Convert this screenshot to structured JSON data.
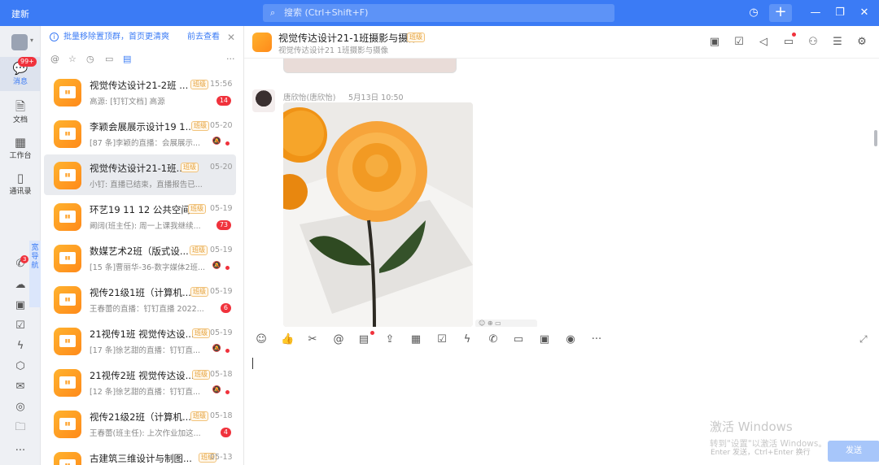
{
  "titlebar": {
    "app_title": "建新",
    "search_placeholder": "搜索 (Ctrl+Shift+F)",
    "icons": [
      "history-icon",
      "plus-icon",
      "minimize-icon",
      "restore-icon",
      "close-icon"
    ]
  },
  "leftnav": {
    "items": [
      {
        "label": "消息",
        "icon": "message-icon",
        "badge": "99+",
        "active": true
      },
      {
        "label": "文档",
        "icon": "document-icon"
      },
      {
        "label": "工作台",
        "icon": "workbench-icon"
      },
      {
        "label": "通讯录",
        "icon": "contacts-icon"
      }
    ],
    "wide_nav_label": "宽导航",
    "call_badge": "3",
    "more_label": "..."
  },
  "notice": {
    "message": "批量移除置顶群，首页更清爽",
    "link": "前去查看"
  },
  "conversations": [
    {
      "name": "视觉传达设计21-2班 ...",
      "tag": "班级",
      "time": "15:56",
      "preview": "高源: [钉钉文档] 高源",
      "badge": "14"
    },
    {
      "name": "李颖会展展示设计19 1...",
      "tag": "班级",
      "time": "05-20",
      "preview": "[87 条]李颖的直播：会展展示...",
      "muted": true,
      "dot": true
    },
    {
      "name": "视觉传达设计21-1班...",
      "tag": "班级",
      "time": "05-20",
      "preview": "小钉: 直播已结束，直播报告已...",
      "selected": true
    },
    {
      "name": "环艺19 11 12 公共空间",
      "tag": "班级",
      "time": "05-19",
      "preview": "阚阔(班主任): 周一上课我继续...",
      "badge": "73"
    },
    {
      "name": "数媒艺术2班（版式设...",
      "tag": "班级",
      "time": "05-19",
      "preview": "[15 条]曹丽华-36-数字媒体2班...",
      "muted": true,
      "dot": true
    },
    {
      "name": "视传21级1班（计算机...",
      "tag": "班级",
      "time": "05-19",
      "preview": "王春蕾的直播：钉钉直播 2022...",
      "badge": "6"
    },
    {
      "name": "21视传1班 视觉传达设...",
      "tag": "班级",
      "time": "05-19",
      "preview": "[17 条]徐艺甜的直播：钉钉直...",
      "muted": true,
      "dot": true
    },
    {
      "name": "21视传2班 视觉传达设...",
      "tag": "班级",
      "time": "05-18",
      "preview": "[12 条]徐艺甜的直播：钉钉直...",
      "muted": true,
      "dot": true
    },
    {
      "name": "视传21级2班（计算机...",
      "tag": "班级",
      "time": "05-18",
      "preview": "王春蕾(班主任): 上次作业加这...",
      "badge": "4"
    },
    {
      "name": "古建筑三维设计与制图...",
      "tag": "班级",
      "time": "05-13",
      "preview": ""
    }
  ],
  "chat": {
    "title": "视觉传达设计21-1班摄影与摄像",
    "tag": "班级",
    "subtitle": "视觉传达设计21  1班摄影与摄像",
    "header_icons": [
      "group-icon",
      "check-icon",
      "speaker-icon",
      "inbox-icon",
      "add-member-icon",
      "search-record-icon",
      "settings-icon"
    ],
    "message": {
      "sender": "唐欣怡(唐欣怡)",
      "time": "5月13日 10:50",
      "image_desc": "photo-orange-flower"
    },
    "toolbar_icons": [
      "emoji-icon",
      "like-icon",
      "scissors-icon",
      "at-icon",
      "task-icon",
      "file-upload-icon",
      "calendar-icon",
      "todo-icon",
      "flash-icon",
      "call-icon",
      "live-icon",
      "screen-share-icon",
      "red-packet-icon",
      "more-icon"
    ],
    "watermark_line1": "激活 Windows",
    "watermark_line2": "转到\"设置\"以激活 Windows。",
    "hint": "Enter 发送，Ctrl+Enter 换行",
    "send_label": "发送"
  }
}
